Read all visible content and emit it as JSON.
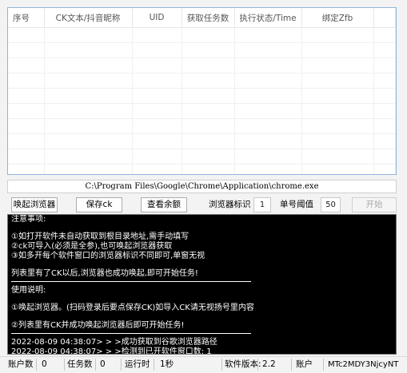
{
  "table": {
    "columns": [
      "序号",
      "CK文本/抖音昵称",
      "UID",
      "获取任务数",
      "执行状态/Time",
      "绑定Zfb"
    ],
    "rows": 11
  },
  "path": "C:\\Program Files\\Google\\Chrome\\Application\\chrome.exe",
  "toolbar": {
    "wake_browser": "唤起浏览器",
    "save_ck": "保存ck",
    "check_balance": "查看余额",
    "browser_id_label": "浏览器标识",
    "browser_id_value": "1",
    "threshold_label": "单号阈值",
    "threshold_value": "50",
    "start": "开始"
  },
  "console": {
    "notes_title": "注意事项:",
    "notes": [
      "①如打开软件未自动获取到根目录地址,需手动填写",
      "②ck可导入(必须是全参),也可唤起浏览器获取",
      "③如多开每个软件窗口的浏览器标识不同即可,单窗无视"
    ],
    "notes_footer": "列表里有了CK以后,浏览器也成功唤起,即可开始任务!",
    "usage_title": "使用说明:",
    "usage": [
      "①唤起浏览器。(扫码登录后要点保存CK)如导入CK请无视扬号里内容",
      "②列表里有CK并成功唤起浏览器后即可开始任务!"
    ],
    "logs": [
      "2022-08-09 04:38:07> > >成功获取到谷歌浏览器路径",
      "2022-08-09 04:38:07> > >检测到已开软件窗口数: 1"
    ]
  },
  "status": {
    "accounts_label": "账户数",
    "accounts_value": "0",
    "tasks_label": "任务数",
    "tasks_value": "0",
    "runtime_label": "运行时",
    "runtime_value": "1秒",
    "version_label": "软件版本:",
    "version_value": "2.2",
    "account_label": "账户",
    "account_value": "MTc2MDY3NjcyNT"
  }
}
